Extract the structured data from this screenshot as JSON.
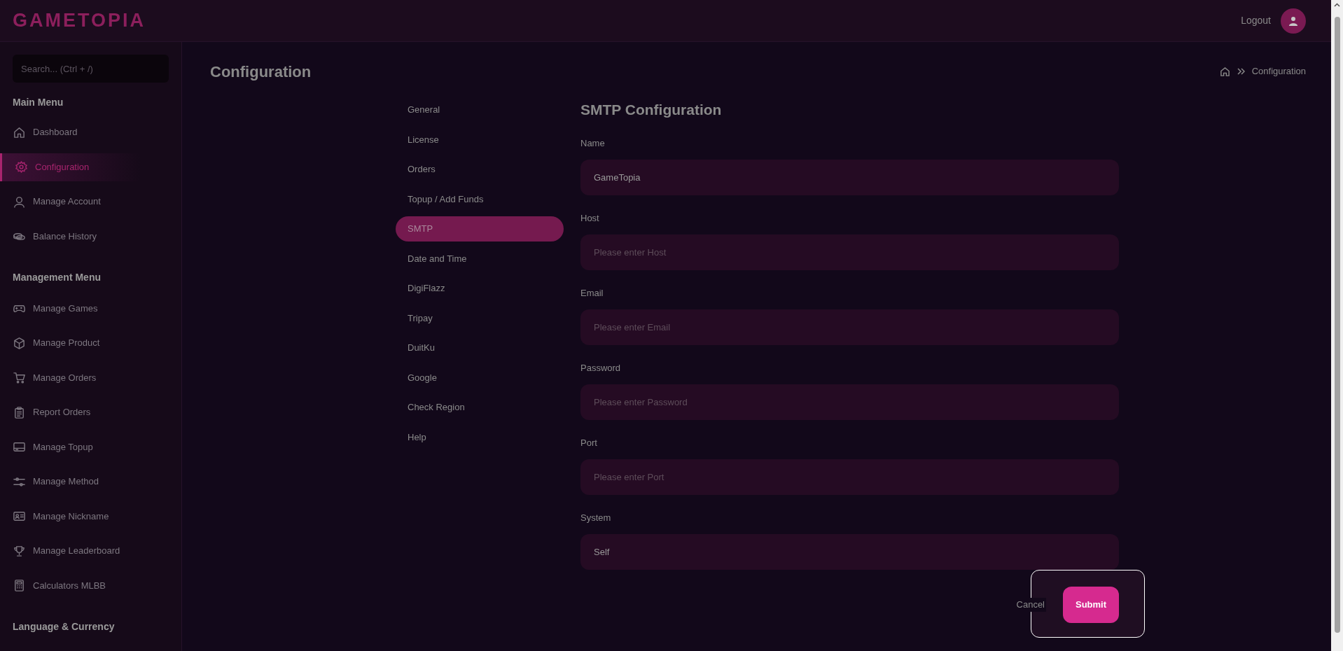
{
  "header": {
    "logo": "GAMETOPIA",
    "logout": "Logout"
  },
  "sidebar": {
    "search_placeholder": "Search... (Ctrl + /)",
    "sections": [
      {
        "title": "Main Menu",
        "items": [
          {
            "label": "Dashboard",
            "selected": false
          },
          {
            "label": "Configuration",
            "selected": true
          },
          {
            "label": "Manage Account",
            "selected": false
          },
          {
            "label": "Balance History",
            "selected": false
          }
        ]
      },
      {
        "title": "Management Menu",
        "items": [
          {
            "label": "Manage Games",
            "selected": false
          },
          {
            "label": "Manage Product",
            "selected": false
          },
          {
            "label": "Manage Orders",
            "selected": false
          },
          {
            "label": "Report Orders",
            "selected": false
          },
          {
            "label": "Manage Topup",
            "selected": false
          },
          {
            "label": "Manage Method",
            "selected": false
          },
          {
            "label": "Manage Nickname",
            "selected": false
          },
          {
            "label": "Manage Leaderboard",
            "selected": false
          },
          {
            "label": "Calculators MLBB",
            "selected": false
          }
        ]
      },
      {
        "title": "Language & Currency"
      }
    ]
  },
  "page": {
    "title": "Configuration",
    "breadcrumb": [
      "Configuration"
    ]
  },
  "config_menu": [
    {
      "label": "General",
      "selected": false
    },
    {
      "label": "License",
      "selected": false
    },
    {
      "label": "Orders",
      "selected": false
    },
    {
      "label": "Topup / Add Funds",
      "selected": false
    },
    {
      "label": "SMTP",
      "selected": true
    },
    {
      "label": "Date and Time",
      "selected": false
    },
    {
      "label": "DigiFlazz",
      "selected": false
    },
    {
      "label": "Tripay",
      "selected": false
    },
    {
      "label": "DuitKu",
      "selected": false
    },
    {
      "label": "Google",
      "selected": false
    },
    {
      "label": "Check Region",
      "selected": false
    },
    {
      "label": "Help",
      "selected": false
    }
  ],
  "form": {
    "title": "SMTP Configuration",
    "fields": [
      {
        "label": "Name",
        "value": "GameTopia"
      },
      {
        "label": "Host",
        "placeholder": "Please enter Host"
      },
      {
        "label": "Email",
        "placeholder": "Please enter Email"
      },
      {
        "label": "Password",
        "placeholder": "Please enter Password"
      },
      {
        "label": "Port",
        "placeholder": "Please enter Port"
      },
      {
        "label": "System",
        "value": "Self"
      }
    ],
    "cancel": "Cancel",
    "submit": "Submit"
  }
}
